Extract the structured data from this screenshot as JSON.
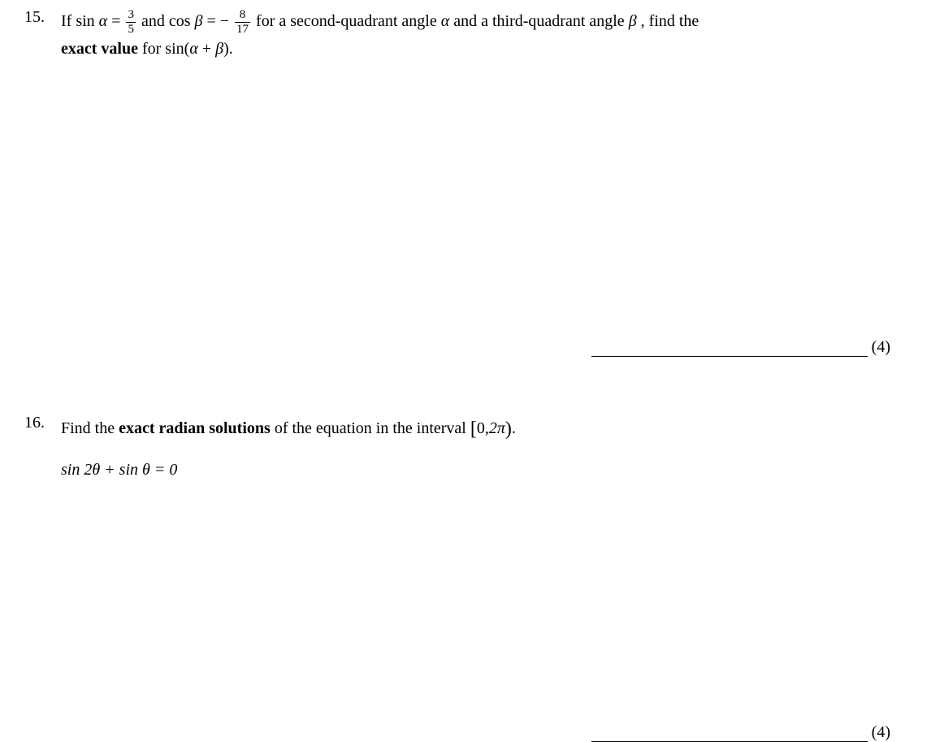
{
  "q15": {
    "number": "15.",
    "text_part1": "If  sin ",
    "alpha": "α",
    "eq1": " = ",
    "frac1_num": "3",
    "frac1_den": "5",
    "text_part2": " and  cos ",
    "beta": "β",
    "eq2": "  =  − ",
    "frac2_num": "8",
    "frac2_den": "17",
    "text_part3": "  for a second-quadrant angle ",
    "text_part4": "  and a third-quadrant angle ",
    "text_part5": " ,  find the",
    "text_part6": "exact value",
    "text_part7": " for  sin(",
    "text_part8": " + ",
    "text_part9": ").",
    "points": "(4)"
  },
  "q16": {
    "number": "16.",
    "text_part1": "Find the ",
    "bold_text": "exact radian solutions",
    "text_part2": " of the equation in the interval  ",
    "interval_open": "[",
    "interval_zero": "0,",
    "interval_2pi": "2π",
    "interval_close": ")",
    "period": ".",
    "equation": "sin 2θ + sin θ  =  0",
    "points": "(4)"
  }
}
